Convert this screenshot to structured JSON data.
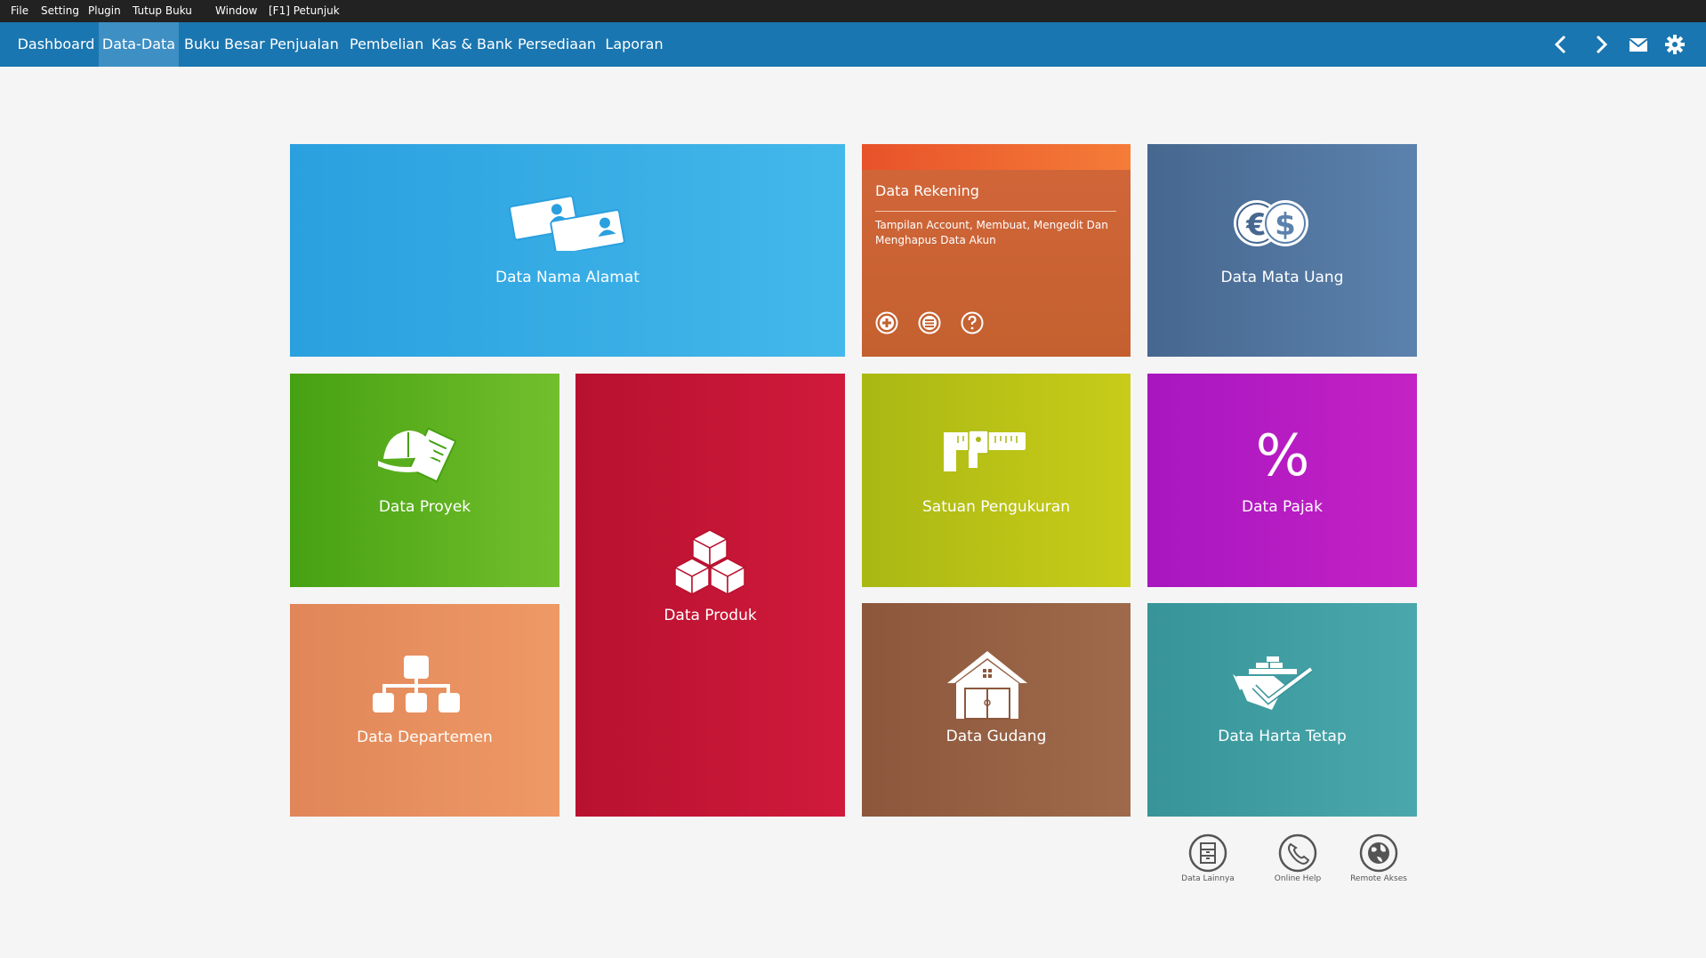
{
  "menu": [
    "File",
    "Setting",
    "Plugin",
    "Tutup Buku",
    "Window",
    "[F1] Petunjuk"
  ],
  "nav": {
    "tabs": [
      "Dashboard",
      "Data-Data",
      "Buku Besar",
      "Penjualan",
      "Pembelian",
      "Kas & Bank",
      "Persediaan",
      "Laporan"
    ],
    "active_tab": "Data-Data",
    "icons": [
      "chevron-left-icon",
      "chevron-right-icon",
      "envelope-icon",
      "gear-icon"
    ]
  },
  "tiles": {
    "nama_alamat": {
      "label": "Data Nama Alamat",
      "icon": "contact-cards-icon"
    },
    "rekening": {
      "title": "Data Rekening",
      "description": "Tampilan Account, Membuat, Mengedit Dan Menghapus Data Akun",
      "actions": [
        "plus-circle-icon",
        "list-circle-icon",
        "question-circle-icon"
      ]
    },
    "mata_uang": {
      "label": "Data Mata Uang",
      "icon": "euro-dollar-coins-icon"
    },
    "proyek": {
      "label": "Data Proyek",
      "icon": "hardhat-notepad-icon"
    },
    "produk": {
      "label": "Data Produk",
      "icon": "boxes-icon"
    },
    "satuan": {
      "label": "Satuan Pengukuran",
      "icon": "caliper-icon"
    },
    "pajak": {
      "label": "Data Pajak",
      "icon": "percent-icon"
    },
    "departemen": {
      "label": "Data Departemen",
      "icon": "org-chart-icon"
    },
    "gudang": {
      "label": "Data Gudang",
      "icon": "warehouse-icon"
    },
    "harta_tetap": {
      "label": "Data Harta Tetap",
      "icon": "checked-box-icon"
    }
  },
  "quick_links": [
    {
      "label": "Data Lainnya",
      "icon": "cabinet-icon"
    },
    {
      "label": "Online Help",
      "icon": "phone-icon"
    },
    {
      "label": "Remote Akses",
      "icon": "globe-icon"
    }
  ],
  "colors": {
    "menubar": "#222222",
    "navbar": "#1a76b0",
    "nama_alamat": "#2aa0df",
    "rekening": "#c4602f",
    "mata_uang": "#46678f",
    "proyek": "#46a112",
    "produk": "#b8112f",
    "satuan": "#aab814",
    "pajak": "#a816c0",
    "departemen": "#e08658",
    "gudang": "#8c573c",
    "harta_tetap": "#379498"
  }
}
